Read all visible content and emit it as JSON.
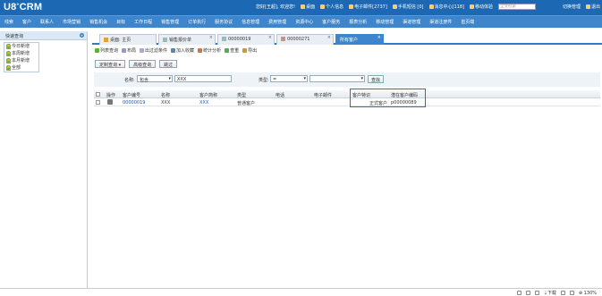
{
  "app": {
    "logo": "U8",
    "logo_sup": "+",
    "logo_suffix": "CRM"
  },
  "topbar": {
    "greeting": "您好[王超], 欢迎您!",
    "links": [
      "桌面",
      "个人信息",
      "电子邮件[2737]",
      "手机短信 [0]",
      "消息中心[118]",
      "移动体验"
    ],
    "search_placeholder": "全文检索",
    "user": "切换管理",
    "logout": "退出"
  },
  "nav": [
    "线索",
    "客户",
    "联系人",
    "市场营销",
    "销售机会",
    "目标",
    "工作日程",
    "销售管理",
    "订单执行",
    "服务协议",
    "信息管理",
    "费用管理",
    "资源中心",
    "客户服务",
    "报表分析",
    "移动管理",
    "渠道管理",
    "渠道注册件",
    "首页端"
  ],
  "sidebar": {
    "title": "快速查询",
    "items": [
      "今日新增",
      "本周新增",
      "本月新增",
      "全部"
    ]
  },
  "tabs": [
    {
      "label": "桌面: 主页",
      "active": false
    },
    {
      "label": "销售报价单",
      "active": false
    },
    {
      "label": "00000019",
      "active": false
    },
    {
      "label": "00000271",
      "active": false
    },
    {
      "label": "所有客户",
      "active": true
    }
  ],
  "toolbar": [
    "列表查询",
    "布局",
    "出过滤条件",
    "加入收藏",
    "统计分析",
    "查重",
    "导出"
  ],
  "buttons": {
    "custom_query": "定制查询",
    "advanced_query": "高级查询",
    "skip": "跳过"
  },
  "filter": {
    "name_label": "名称:",
    "name_op": "包含",
    "name_value": "XXX",
    "type_label": "类型:",
    "type_op": "=",
    "type_value": "",
    "search": "查找"
  },
  "table": {
    "headers": [
      "操作",
      "客户编号",
      "名称",
      "客户简称",
      "类型",
      "电话",
      "电子邮件",
      "客户特识",
      "潜在客户编码"
    ],
    "rows": [
      [
        "",
        "00000019",
        "XXX",
        "XXX",
        "普通客户",
        "",
        "",
        "正式客户",
        "p00000089"
      ]
    ]
  },
  "footer": {
    "download": "下载",
    "zoom": "130%"
  },
  "colors": {
    "topbar": "#1c68b3",
    "nav": "#3d86cd",
    "highlight": "#e0302e"
  }
}
